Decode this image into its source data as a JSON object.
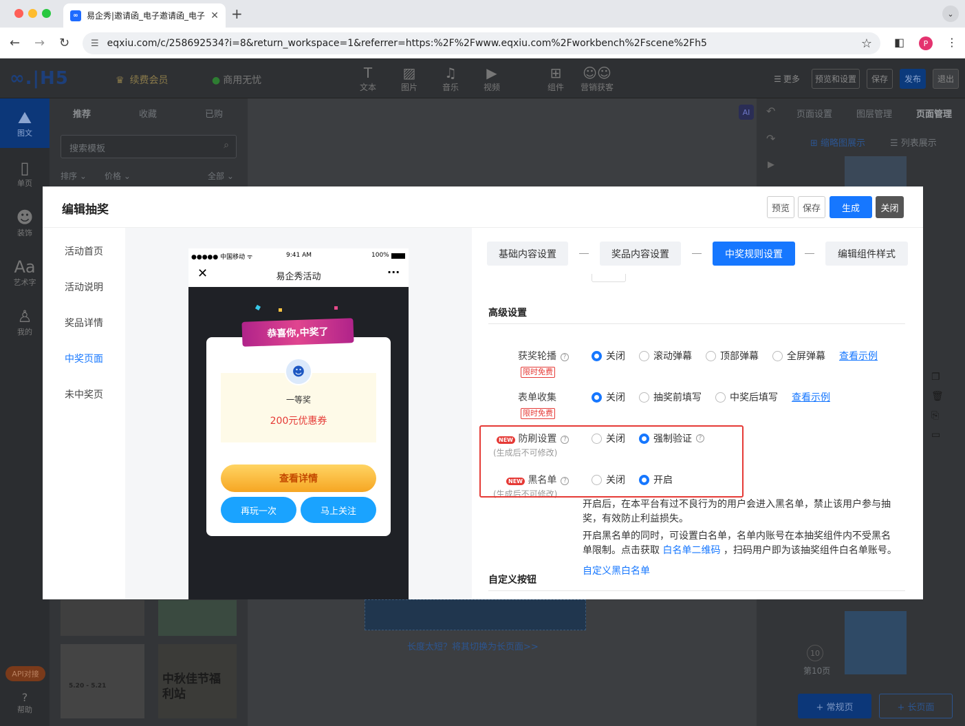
{
  "browser": {
    "tab_title": "易企秀|邀请函_电子邀请函_电子",
    "url": "eqxiu.com/c/258692534?i=8&return_workspace=1&referrer=https:%2F%2Fwww.eqxiu.com%2Fworkbench%2Fscene%2Fh5",
    "avatar_letter": "P"
  },
  "app_header": {
    "logo": "∞.|H5",
    "vip": "续费会员",
    "commercial": "商用无忧",
    "tools": [
      "文本",
      "图片",
      "音乐",
      "视频",
      "组件",
      "营销获客"
    ],
    "more": "更多",
    "preview_settings": "预览和设置",
    "save": "保存",
    "publish": "发布",
    "exit": "退出"
  },
  "left_nav": [
    "图文",
    "单页",
    "装饰",
    "艺术字",
    "我的"
  ],
  "left_nav_bottom": {
    "api": "API对接",
    "help": "帮助"
  },
  "template_panel": {
    "tabs": [
      "推荐",
      "收藏",
      "已购"
    ],
    "search_placeholder": "搜索模板",
    "filters": [
      "排序",
      "价格",
      "全部"
    ],
    "thumb_text": "中秋佳节福利站",
    "thumb_text2": "5.20 - 5.21"
  },
  "canvas": {
    "switch_link": "长度太短？将其切换为长页面>>"
  },
  "right_panel": {
    "tabs": [
      "页面设置",
      "图层管理",
      "页面管理"
    ],
    "view_thumb": "缩略图展示",
    "view_list": "列表展示",
    "page_label": "第10页",
    "page_num": "10",
    "add_normal": "+ 常规页",
    "add_long": "+ 长页面"
  },
  "modal": {
    "title": "编辑抽奖",
    "btn_preview": "预览",
    "btn_save": "保存",
    "btn_generate": "生成",
    "btn_close": "关闭",
    "nav": [
      "活动首页",
      "活动说明",
      "奖品详情",
      "中奖页面",
      "未中奖页"
    ],
    "active_nav_index": 3,
    "phone": {
      "carrier": "●●●●● 中国移动 ᯤ",
      "time": "9:41 AM",
      "battery": "100%",
      "nav_title": "易企秀活动",
      "banner": "恭喜你,中奖了",
      "prize_level": "一等奖",
      "prize_name": "200元优惠券",
      "btn_detail": "查看详情",
      "btn_replay": "再玩一次",
      "btn_follow": "马上关注"
    },
    "steps": [
      "基础内容设置",
      "奖品内容设置",
      "中奖规则设置",
      "编辑组件样式"
    ],
    "active_step_index": 2,
    "advanced": {
      "title": "高级设置",
      "free_tag": "限时免费",
      "new_tag": "NEW",
      "no_edit_hint": "(生成后不可修改)",
      "see_example": "查看示例",
      "rows": [
        {
          "label": "获奖轮播",
          "options": [
            "关闭",
            "滚动弹幕",
            "顶部弹幕",
            "全屏弹幕"
          ],
          "selected": 0
        },
        {
          "label": "表单收集",
          "options": [
            "关闭",
            "抽奖前填写",
            "中奖后填写"
          ],
          "selected": 0
        },
        {
          "label": "防刷设置",
          "options": [
            "关闭",
            "强制验证"
          ],
          "selected": 1
        },
        {
          "label": "黑名单",
          "options": [
            "关闭",
            "开启"
          ],
          "selected": 1
        }
      ],
      "desc1": "开启后，在本平台有过不良行为的用户会进入黑名单，禁止该用户参与抽奖，有效防止利益损失。",
      "desc2_a": "开启黑名单的同时，可设置白名单，名单内账号在本抽奖组件内不受黑名单限制。点击获取",
      "desc2_link": "白名单二维码",
      "desc2_b": "，扫码用户即为该抽奖组件白名单账号。",
      "custom_blacklist": "自定义黑白名单"
    },
    "custom_button_title": "自定义按钮"
  }
}
